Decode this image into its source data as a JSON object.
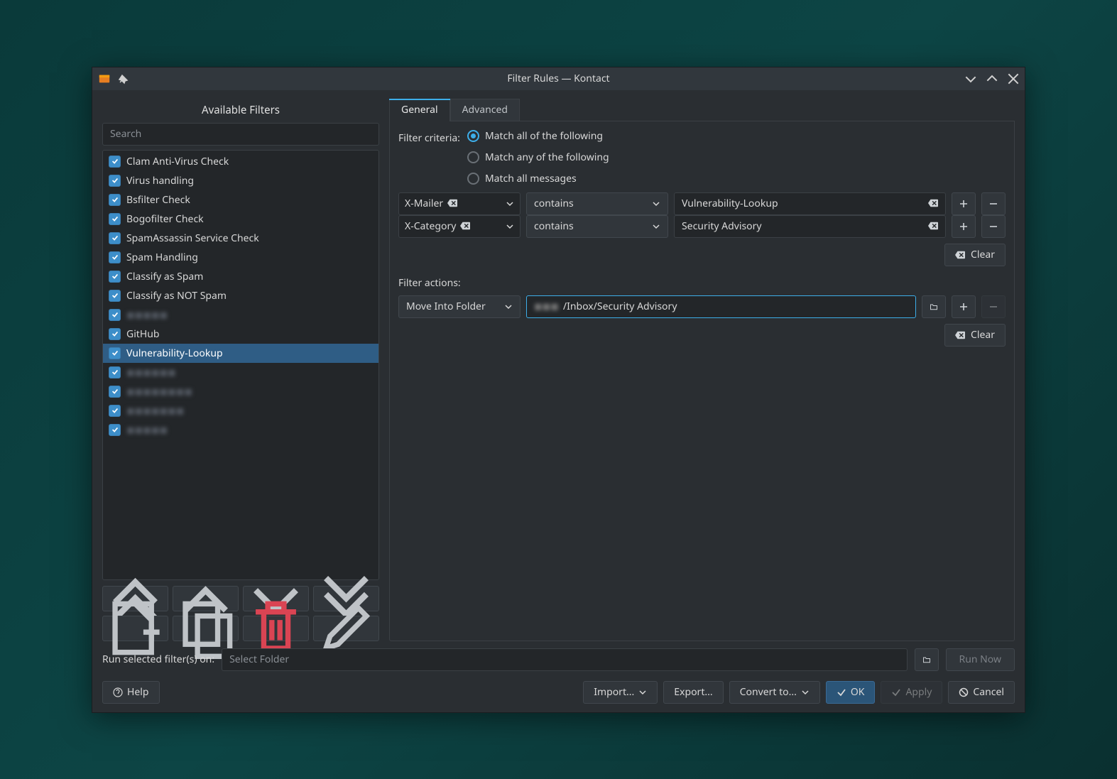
{
  "window": {
    "title": "Filter Rules — Kontact"
  },
  "left": {
    "title": "Available Filters",
    "search_placeholder": "Search",
    "filters": [
      {
        "label": "Clam Anti-Virus Check",
        "checked": true,
        "selected": false,
        "blurred": false
      },
      {
        "label": "Virus handling",
        "checked": true,
        "selected": false,
        "blurred": false
      },
      {
        "label": "Bsfilter Check",
        "checked": true,
        "selected": false,
        "blurred": false
      },
      {
        "label": "Bogofilter Check",
        "checked": true,
        "selected": false,
        "blurred": false
      },
      {
        "label": "SpamAssassin Service Check",
        "checked": true,
        "selected": false,
        "blurred": false
      },
      {
        "label": "Spam Handling",
        "checked": true,
        "selected": false,
        "blurred": false
      },
      {
        "label": "Classify as Spam",
        "checked": true,
        "selected": false,
        "blurred": false
      },
      {
        "label": "Classify as NOT Spam",
        "checked": true,
        "selected": false,
        "blurred": false
      },
      {
        "label": "◼◼◼◼◼",
        "checked": true,
        "selected": false,
        "blurred": true
      },
      {
        "label": "GitHub",
        "checked": true,
        "selected": false,
        "blurred": false
      },
      {
        "label": "Vulnerability-Lookup",
        "checked": true,
        "selected": true,
        "blurred": false
      },
      {
        "label": "◼◼◼◼◼◼",
        "checked": true,
        "selected": false,
        "blurred": true
      },
      {
        "label": "◼◼◼◼◼◼◼◼",
        "checked": true,
        "selected": false,
        "blurred": true
      },
      {
        "label": "◼◼◼◼◼◼◼",
        "checked": true,
        "selected": false,
        "blurred": true
      },
      {
        "label": "◼◼◼◼◼",
        "checked": true,
        "selected": false,
        "blurred": true
      }
    ]
  },
  "tabs": {
    "general": "General",
    "advanced": "Advanced"
  },
  "criteria": {
    "label": "Filter criteria:",
    "match_all": "Match all of the following",
    "match_any": "Match any of the following",
    "match_msgs": "Match all messages",
    "selected": "all",
    "rules": [
      {
        "field": "X-Mailer",
        "op": "contains",
        "value": "Vulnerability-Lookup"
      },
      {
        "field": "X-Category",
        "op": "contains",
        "value": "Security Advisory"
      }
    ],
    "clear": "Clear"
  },
  "actions": {
    "label": "Filter actions:",
    "rows": [
      {
        "action": "Move Into Folder",
        "folder_prefix": "◼◼◼",
        "folder": "/Inbox/Security Advisory"
      }
    ],
    "clear": "Clear"
  },
  "runrow": {
    "label": "Run selected filter(s) on:",
    "placeholder": "Select Folder",
    "run": "Run Now"
  },
  "buttons": {
    "help": "Help",
    "import": "Import...",
    "export": "Export...",
    "convert": "Convert to...",
    "ok": "OK",
    "apply": "Apply",
    "cancel": "Cancel"
  }
}
